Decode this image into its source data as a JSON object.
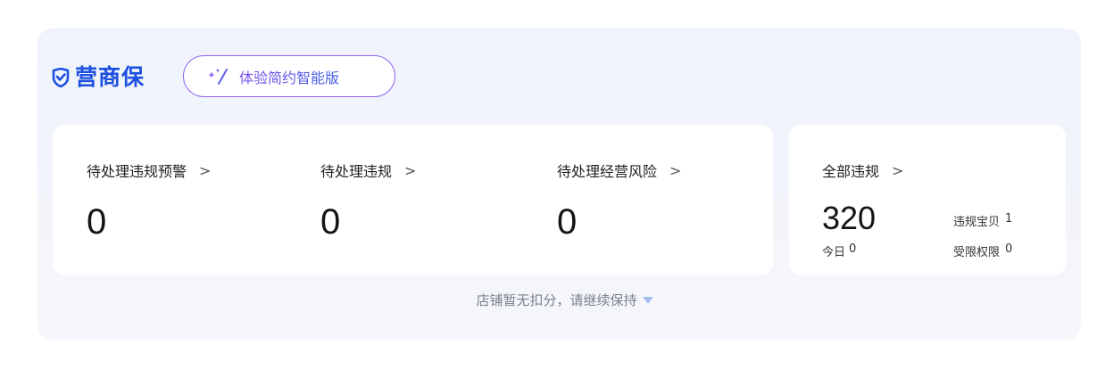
{
  "brand": {
    "name": "营商保",
    "icon": "shield-check-icon",
    "color": "#1d4fe0"
  },
  "promo": {
    "label": "体验简约智能版",
    "icon": "magic-wand-icon",
    "accent": "#8c60f5"
  },
  "metrics": [
    {
      "label": "待处理违规预警",
      "value": "0"
    },
    {
      "label": "待处理违规",
      "value": "0"
    },
    {
      "label": "待处理经营风险",
      "value": "0"
    }
  ],
  "summary": {
    "label": "全部违规",
    "total": "320",
    "today_label": "今日",
    "today_value": "0",
    "stats": [
      {
        "label": "违规宝贝",
        "value": "1"
      },
      {
        "label": "受限权限",
        "value": "0"
      }
    ]
  },
  "footer": {
    "note": "店铺暂无扣分，请继续保持",
    "icon": "caret-down-icon"
  },
  "chevron": ">"
}
